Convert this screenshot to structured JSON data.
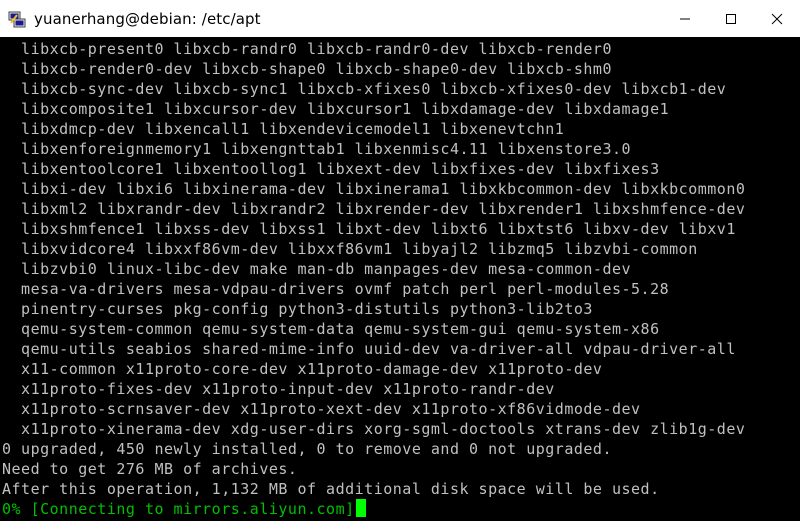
{
  "window": {
    "title": "yuanerhang@debian: /etc/apt",
    "icons": {
      "app": "putty-icon",
      "minimize": "minimize-icon",
      "maximize": "maximize-icon",
      "close": "close-icon"
    }
  },
  "terminal": {
    "lines": [
      "  libxcb-present0 libxcb-randr0 libxcb-randr0-dev libxcb-render0",
      "  libxcb-render0-dev libxcb-shape0 libxcb-shape0-dev libxcb-shm0",
      "  libxcb-sync-dev libxcb-sync1 libxcb-xfixes0 libxcb-xfixes0-dev libxcb1-dev",
      "  libxcomposite1 libxcursor-dev libxcursor1 libxdamage-dev libxdamage1",
      "  libxdmcp-dev libxencall1 libxendevicemodel1 libxenevtchn1",
      "  libxenforeignmemory1 libxengnttab1 libxenmisc4.11 libxenstore3.0",
      "  libxentoolcore1 libxentoollog1 libxext-dev libxfixes-dev libxfixes3",
      "  libxi-dev libxi6 libxinerama-dev libxinerama1 libxkbcommon-dev libxkbcommon0",
      "  libxml2 libxrandr-dev libxrandr2 libxrender-dev libxrender1 libxshmfence-dev",
      "  libxshmfence1 libxss-dev libxss1 libxt-dev libxt6 libxtst6 libxv-dev libxv1",
      "  libxvidcore4 libxxf86vm-dev libxxf86vm1 libyajl2 libzmq5 libzvbi-common",
      "  libzvbi0 linux-libc-dev make man-db manpages-dev mesa-common-dev",
      "  mesa-va-drivers mesa-vdpau-drivers ovmf patch perl perl-modules-5.28",
      "  pinentry-curses pkg-config python3-distutils python3-lib2to3",
      "  qemu-system-common qemu-system-data qemu-system-gui qemu-system-x86",
      "  qemu-utils seabios shared-mime-info uuid-dev va-driver-all vdpau-driver-all",
      "  x11-common x11proto-core-dev x11proto-damage-dev x11proto-dev",
      "  x11proto-fixes-dev x11proto-input-dev x11proto-randr-dev",
      "  x11proto-scrnsaver-dev x11proto-xext-dev x11proto-xf86vidmode-dev",
      "  x11proto-xinerama-dev xdg-user-dirs xorg-sgml-doctools xtrans-dev zlib1g-dev",
      "0 upgraded, 450 newly installed, 0 to remove and 0 not upgraded.",
      "Need to get 276 MB of archives.",
      "After this operation, 1,132 MB of additional disk space will be used."
    ],
    "status_line": "0% [Connecting to mirrors.aliyun.com]",
    "colors": {
      "background": "#000000",
      "text": "#c0c0c0",
      "status": "#00c000",
      "cursor": "#00ff00"
    }
  }
}
